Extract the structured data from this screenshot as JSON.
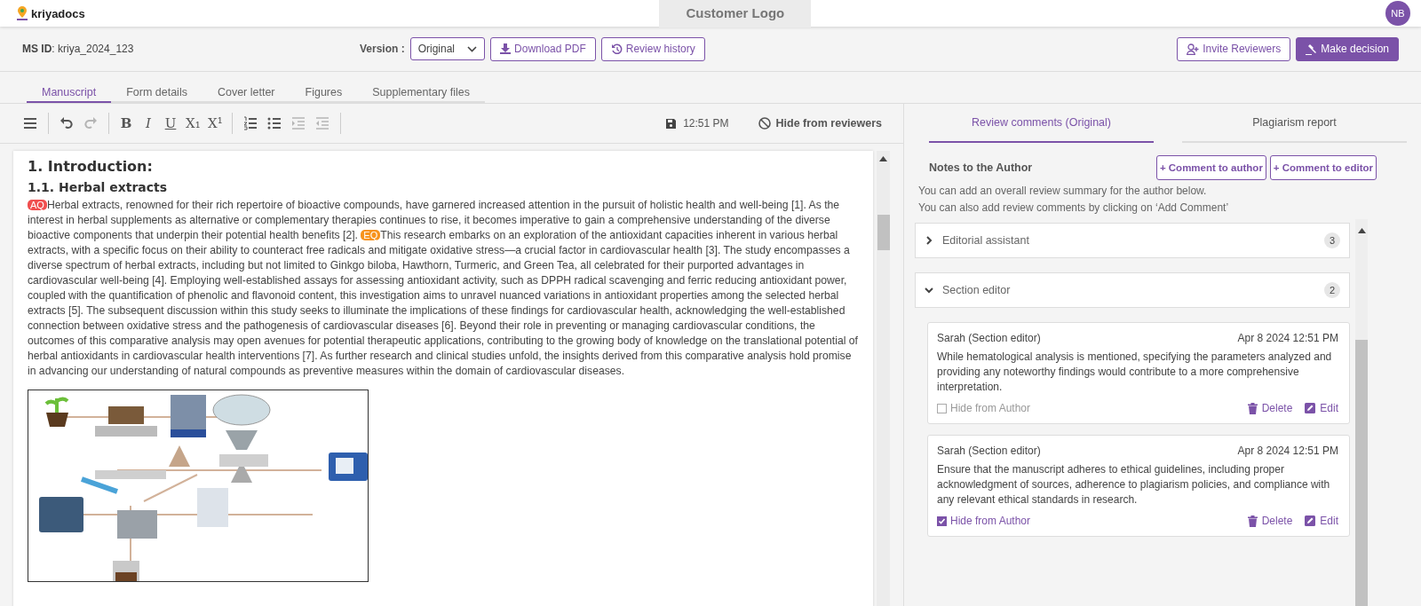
{
  "header": {
    "logo": "kriyadocs",
    "center_tab": "Customer Logo",
    "avatar": "NB"
  },
  "msbar": {
    "ms_id": "**MS ID**: kriya_2024_123",
    "version_label": "Version :",
    "version_value": "Original",
    "buttons": [
      {
        "kind": "download",
        "label": "Download PDF"
      },
      {
        "kind": "history",
        "label": "Review history"
      }
    ],
    "right_buttons": [
      {
        "kind": "invite",
        "label": "Invite Reviewers",
        "primary": false
      },
      {
        "kind": "gavel",
        "label": "Make decision",
        "primary": true
      }
    ]
  },
  "tabs": [
    {
      "label": "Manuscript",
      "selected": true
    },
    {
      "label": "Form details",
      "selected": false
    },
    {
      "label": "Cover letter",
      "selected": false
    },
    {
      "label": "Figures",
      "selected": false
    },
    {
      "label": "Supplementary files",
      "selected": false
    }
  ],
  "editor": {
    "tools": [
      {
        "kind": "menu",
        "disabled": false
      },
      {
        "kind": "sep"
      },
      {
        "kind": "undo",
        "disabled": false
      },
      {
        "kind": "redo",
        "disabled": true
      },
      {
        "kind": "sep"
      },
      {
        "kind": "bold",
        "glyph": "B",
        "disabled": false
      },
      {
        "kind": "italic",
        "glyph": "I",
        "disabled": false
      },
      {
        "kind": "underline",
        "glyph": "U",
        "disabled": false
      },
      {
        "kind": "subscript",
        "glyph": "X₁",
        "disabled": false
      },
      {
        "kind": "superscript",
        "glyph": "X¹",
        "disabled": false
      },
      {
        "kind": "sep"
      },
      {
        "kind": "ordered-list",
        "disabled": false
      },
      {
        "kind": "bullet-list",
        "disabled": false
      },
      {
        "kind": "indent",
        "disabled": true
      },
      {
        "kind": "outdent",
        "disabled": true
      },
      {
        "kind": "sep"
      }
    ],
    "save_time": "12:51 PM",
    "hide_button": "Hide from reviewers",
    "heading": "1. Introduction:",
    "subheading": "1.1. Herbal extracts",
    "paragraph": [
      {
        "kind": "badge",
        "text": "AQ",
        "color": "#f04f4f"
      },
      {
        "kind": "text",
        "text": "Herbal extracts, renowned for their rich repertoire of bioactive compounds, have garnered increased attention in the pursuit of holistic health and well-being [1]. As the interest in herbal supplements as alternative or complementary therapies continues to rise, it becomes imperative to gain a comprehensive understanding of the diverse bioactive components that underpin their potential health benefits [2]. "
      },
      {
        "kind": "badge",
        "text": "EQ",
        "color": "#f7931e"
      },
      {
        "kind": "text",
        "text": "This research embarks on an exploration of the antioxidant capacities inherent in various herbal extracts, with a specific focus on their ability to counteract free radicals and mitigate oxidative stress—a crucial factor in cardiovascular health [3]. The study encompasses a diverse spectrum of herbal extracts, including but not limited to Ginkgo biloba, Hawthorn, Turmeric, and Green Tea, all celebrated for their purported advantages in cardiovascular well-being [4]. Employing well-established assays for assessing antioxidant activity, such as DPPH radical scavenging and ferric reducing antioxidant power, coupled with the quantification of phenolic and flavonoid content, this investigation aims to unravel nuanced variations in antioxidant properties among the selected herbal extracts [5]. The subsequent discussion within this study seeks to illuminate the implications of these findings for cardiovascular health, acknowledging the well-established connection between oxidative stress and the pathogenesis of cardiovascular diseases [6]. Beyond their role in preventing or managing cardiovascular conditions, the outcomes of this comparative analysis may open avenues for potential therapeutic applications, contributing to the growing body of knowledge on the translational potential of herbal antioxidants in cardiovascular health interventions [7]. As further research and clinical studies unfold, the insights derived from this comparative analysis hold promise in advancing our understanding of natural compounds as preventive measures within the domain of cardiovascular diseases."
      }
    ]
  },
  "review": {
    "tabs": [
      {
        "label": "Review comments (Original)",
        "selected": true
      },
      {
        "label": "Plagiarism report",
        "selected": false
      }
    ],
    "notes_title": "Notes to the Author",
    "buttons": [
      "+ Comment to author",
      "+ Comment to editor"
    ],
    "hints": [
      "You can add an overall review summary for the author below.",
      "You can also add review comments by clicking on ‘Add Comment’"
    ],
    "groups": [
      {
        "title": "Editorial assistant",
        "count": "3",
        "expanded": false
      },
      {
        "title": "Section editor",
        "count": "2",
        "expanded": true,
        "comments": [
          {
            "author": "Sarah (Section editor)",
            "date": "Apr 8 2024 12:51 PM",
            "text": "While hematological analysis is mentioned, specifying the parameters analyzed and providing any noteworthy findings would contribute to a more comprehensive interpretation.",
            "hide_label": "Hide from Author",
            "hidden": false,
            "actions": [
              {
                "kind": "delete",
                "label": "Delete"
              },
              {
                "kind": "edit",
                "label": "Edit"
              }
            ]
          },
          {
            "author": "Sarah (Section editor)",
            "date": "Apr 8 2024 12:51 PM",
            "text": "Ensure that the manuscript adheres to ethical guidelines, including proper acknowledgment of sources, adherence to plagiarism policies, and compliance with any relevant ethical standards in research.",
            "hide_label": "Hide from Author",
            "hidden": true,
            "actions": [
              {
                "kind": "delete",
                "label": "Delete"
              },
              {
                "kind": "edit",
                "label": "Edit"
              }
            ]
          }
        ]
      }
    ]
  }
}
